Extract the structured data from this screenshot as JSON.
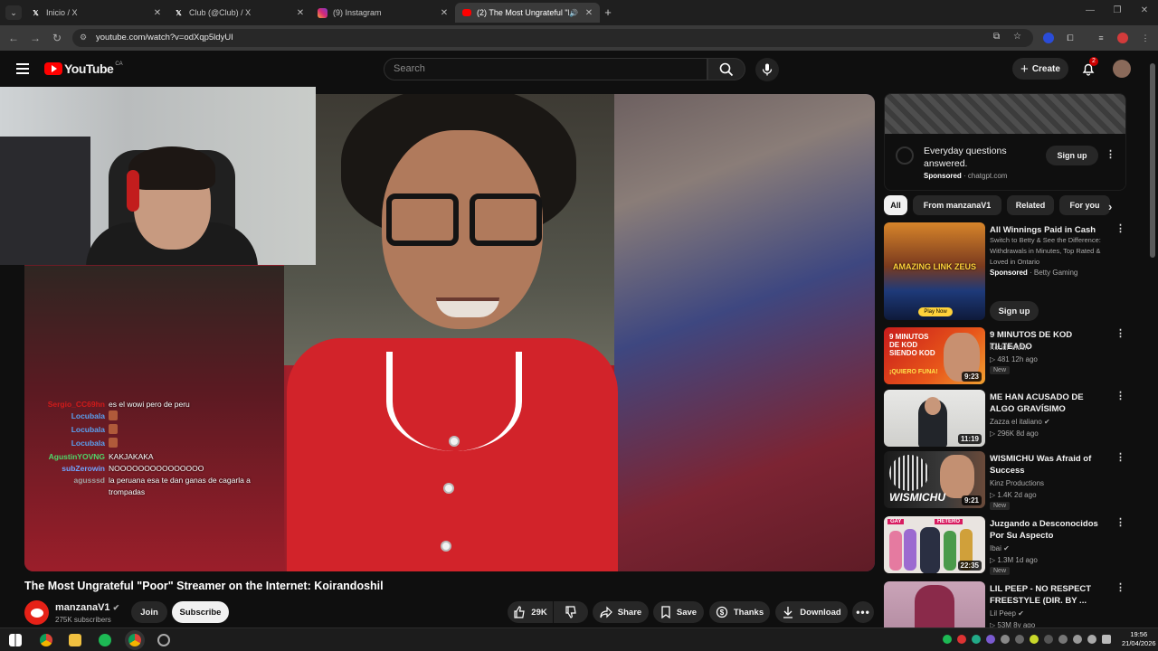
{
  "browser": {
    "tabs": [
      {
        "title": "Inicio / X",
        "favicon": "x-icon",
        "active": false
      },
      {
        "title": "Club (@Club) / X",
        "favicon": "x-icon",
        "active": false
      },
      {
        "title": "(9) Instagram",
        "favicon": "instagram-icon",
        "active": false
      },
      {
        "title": "(2) The Most Ungrateful \"Po",
        "favicon": "youtube-icon",
        "active": true
      }
    ],
    "url": "youtube.com/watch?v=odXqp5ldyUI"
  },
  "header": {
    "logo_text": "YouTube",
    "country": "CA",
    "search_placeholder": "Search",
    "create_label": "Create",
    "notification_count": "2"
  },
  "video": {
    "title": "The Most Ungrateful \"Poor\" Streamer on the Internet: Koirandoshil",
    "channel": "manzanaV1",
    "subscribers": "275K subscribers",
    "join_label": "Join",
    "subscribe_label": "Subscribe",
    "likes": "29K",
    "share_label": "Share",
    "save_label": "Save",
    "thanks_label": "Thanks",
    "download_label": "Download"
  },
  "chat": [
    {
      "user": "Sergio_CC69hn",
      "msg": "es el wowi pero de peru",
      "color": "#d01a1a"
    },
    {
      "user": "Locubala",
      "msg": "",
      "color": "#5aa0f0"
    },
    {
      "user": "Locubala",
      "msg": "",
      "color": "#5aa0f0"
    },
    {
      "user": "Locubala",
      "msg": "",
      "color": "#5aa0f0"
    },
    {
      "user": "AgustinYOVNG",
      "msg": "KAKJAKAKA",
      "color": "#4fd86a"
    },
    {
      "user": "subZerowin",
      "msg": "NOOOOOOOOOOOOOOO",
      "color": "#6fa4ff"
    },
    {
      "user": "agusssd",
      "msg": "la peruana esa te dan ganas de cagarla a trompadas",
      "color": "#a0a0a0"
    }
  ],
  "ad": {
    "title": "Everyday questions answered.",
    "sponsored": "Sponsored",
    "domain": "chatgpt.com",
    "signup": "Sign up"
  },
  "chips": [
    "All",
    "From manzanaV1",
    "Related",
    "For you"
  ],
  "recommendations": [
    {
      "title": "All Winnings Paid in Cash",
      "desc": "Switch to Betty & See the Difference: Withdrawals in Minutes, Top Rated & Loved in Ontario",
      "sponsored": "Sponsored",
      "advertiser": "Betty Gaming",
      "signup": "Sign up",
      "thumb_text": "AMAZING LINK ZEUS",
      "cta": "Play Now"
    },
    {
      "title": "9 MINUTOS DE KOD TILTEADO",
      "channel": "KoddPelotin",
      "stats": "▷ 481  12h ago",
      "badge": "New",
      "duration": "9:23",
      "thumb_text": "9 MINUTOS DE KOD SIENDO KOD",
      "thumb_sub": "¡QUIERO FUNA!"
    },
    {
      "title": "ME HAN ACUSADO DE ALGO GRAVÍSIMO",
      "channel": "Zazza el italiano",
      "stats": "▷ 296K  8d ago",
      "duration": "11:19"
    },
    {
      "title": "WISMICHU Was Afraid of Success",
      "channel": "Kinz Productions",
      "stats": "▷ 1.4K  2d ago",
      "badge": "New",
      "duration": "9:21",
      "thumb_text": "WISMICHU"
    },
    {
      "title": "Juzgando a Desconocidos Por Su Aspecto",
      "channel": "Ibai",
      "stats": "▷ 1.3M  1d ago",
      "badge": "New",
      "duration": "22:35",
      "thumb_text": "GAY",
      "thumb_text2": "HETERO"
    },
    {
      "title": "LIL PEEP - NO RESPECT FREESTYLE  (DIR. BY ...",
      "channel": "Lil Peep",
      "stats": "▷ 53M  8y ago"
    }
  ],
  "taskbar": {
    "time": "19:56",
    "date": "21/04/2026"
  }
}
